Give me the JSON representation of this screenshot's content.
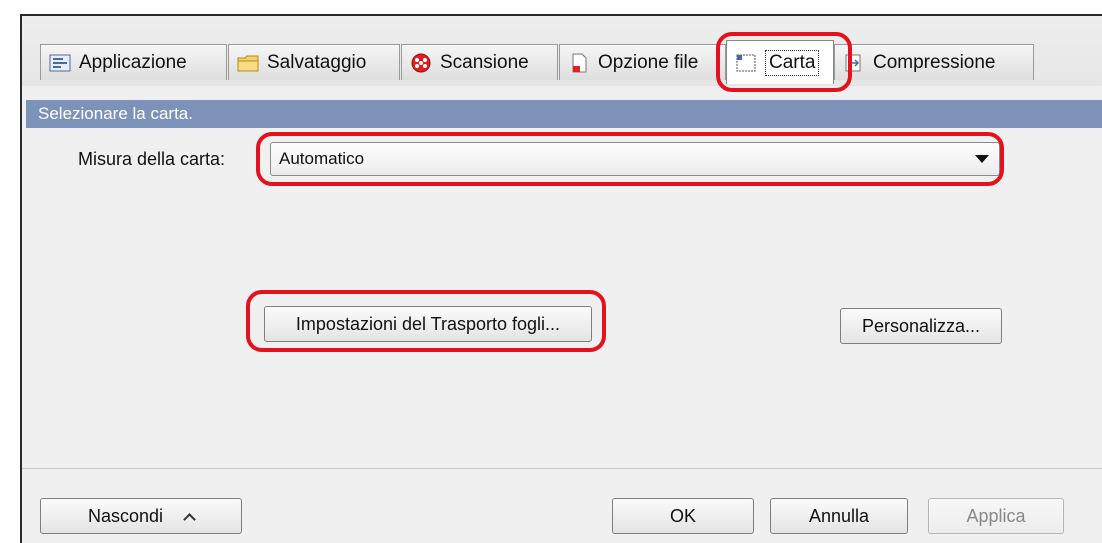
{
  "tabs": [
    {
      "label": "Applicazione",
      "icon": "application-settings-icon"
    },
    {
      "label": "Salvataggio",
      "icon": "folder-icon"
    },
    {
      "label": "Scansione",
      "icon": "scan-icon"
    },
    {
      "label": "Opzione file",
      "icon": "file-option-icon"
    },
    {
      "label": "Carta",
      "icon": "paper-icon",
      "active": true
    },
    {
      "label": "Compressione",
      "icon": "compression-icon"
    }
  ],
  "section": {
    "title": "Selezionare la carta."
  },
  "paper": {
    "size_label": "Misura della carta:",
    "size_value": "Automatico"
  },
  "buttons": {
    "carrier_sheet": "Impostazioni del Trasporto fogli...",
    "customize": "Personalizza..."
  },
  "footer": {
    "hide": "Nascondi",
    "ok": "OK",
    "cancel": "Annulla",
    "apply": "Applica"
  },
  "colors": {
    "highlight": "#e3121f",
    "section_bar": "#7d92b8"
  }
}
